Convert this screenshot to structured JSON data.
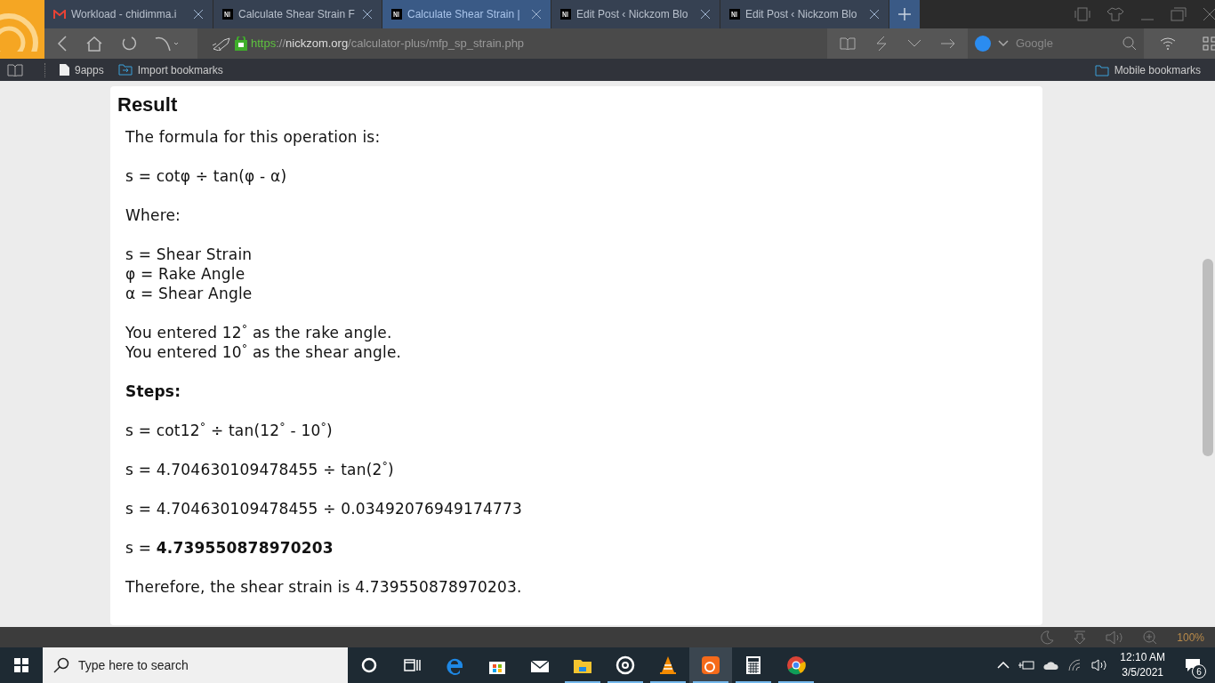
{
  "tabs": [
    {
      "kind": "gmail",
      "title": "Workload - chidimma.i",
      "selected": false
    },
    {
      "kind": "nickzom",
      "title": "Calculate Shear Strain F",
      "selected": false
    },
    {
      "kind": "nickzom",
      "title": "Calculate Shear Strain |",
      "selected": true
    },
    {
      "kind": "nickzom",
      "title": "Edit Post ‹ Nickzom Blo",
      "selected": false
    },
    {
      "kind": "nickzom",
      "title": "Edit Post ‹ Nickzom Blo",
      "selected": false
    }
  ],
  "address": {
    "scheme": "https",
    "separator": "://",
    "domain": "nickzom.org",
    "path": "/calculator-plus/mfp_sp_strain.php"
  },
  "search": {
    "placeholder": "Google"
  },
  "bookmarks": [
    {
      "label": "9apps"
    },
    {
      "label": "Import bookmarks"
    }
  ],
  "mobile_bookmarks": "Mobile bookmarks",
  "result": {
    "heading": "Result",
    "paragraphs": [
      {
        "kind": "text",
        "lines": [
          "The formula for this operation is:"
        ]
      },
      {
        "kind": "text",
        "lines": [
          "s = cotφ ÷ tan(φ - α)"
        ]
      },
      {
        "kind": "text",
        "lines": [
          "Where:"
        ]
      },
      {
        "kind": "text",
        "lines": [
          "s = Shear Strain",
          "φ = Rake Angle",
          "α = Shear Angle"
        ]
      },
      {
        "kind": "text",
        "lines": [
          "You entered 12$^{°}$ as the rake angle.",
          "You entered 10$^{°}$ as the shear angle."
        ]
      },
      {
        "kind": "heading",
        "lines": [
          "Steps:"
        ]
      },
      {
        "kind": "text",
        "lines": [
          "s = cot12$^{°}$ ÷ tan(12$^{°}$ - 10$^{°}$)"
        ]
      },
      {
        "kind": "text",
        "lines": [
          "s = 4.704630109478455 ÷ tan(2$^{°}$)"
        ]
      },
      {
        "kind": "text",
        "lines": [
          "s = 4.704630109478455 ÷ 0.03492076949174773"
        ]
      },
      {
        "kind": "text",
        "lines": [
          "s = **4.739550878970203**"
        ]
      },
      {
        "kind": "text",
        "lines": [
          "Therefore, the shear strain is 4.739550878970203."
        ]
      }
    ]
  },
  "status_bar": {
    "zoom": "100%"
  },
  "taskbar": {
    "search_placeholder": "Type here to search",
    "apps": [
      {
        "kind": "cortana",
        "running": false,
        "active": false
      },
      {
        "kind": "taskview",
        "running": false,
        "active": false
      },
      {
        "kind": "edge",
        "running": false,
        "active": false
      },
      {
        "kind": "store",
        "running": false,
        "active": false
      },
      {
        "kind": "mail",
        "running": false,
        "active": false
      },
      {
        "kind": "explorer",
        "running": true,
        "active": false
      },
      {
        "kind": "groove",
        "running": true,
        "active": false
      },
      {
        "kind": "vlc",
        "running": true,
        "active": false
      },
      {
        "kind": "uc",
        "running": true,
        "active": true
      },
      {
        "kind": "calculator",
        "running": true,
        "active": false
      },
      {
        "kind": "chrome",
        "running": true,
        "active": false
      }
    ],
    "time": "12:10 AM",
    "date": "3/5/2021",
    "notifications": "6"
  }
}
